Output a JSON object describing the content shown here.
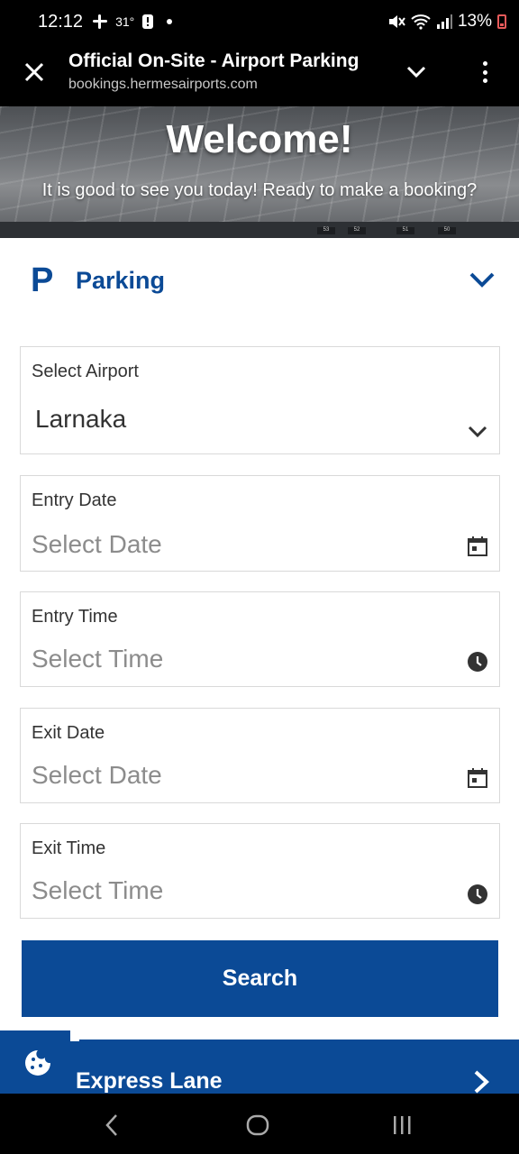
{
  "status_bar": {
    "time": "12:12",
    "temp": "31°",
    "battery": "13%"
  },
  "browser": {
    "title": "Official On-Site - Airport Parking",
    "url": "bookings.hermesairports.com"
  },
  "hero": {
    "heading": "Welcome!",
    "subheading": "It is good to see you today! Ready to make a booking?",
    "signs": [
      "53",
      "52",
      "51",
      "50"
    ]
  },
  "section": {
    "icon_letter": "P",
    "label": "Parking"
  },
  "form": {
    "airport": {
      "label": "Select Airport",
      "value": "Larnaka"
    },
    "entry_date": {
      "label": "Entry Date",
      "placeholder": "Select Date"
    },
    "entry_time": {
      "label": "Entry Time",
      "placeholder": "Select Time"
    },
    "exit_date": {
      "label": "Exit Date",
      "placeholder": "Select Date"
    },
    "exit_time": {
      "label": "Exit Time",
      "placeholder": "Select Time"
    },
    "search_label": "Search"
  },
  "express_lane": {
    "label": "Express Lane"
  },
  "colors": {
    "brand": "#0b4a96"
  },
  "icons": {
    "status_left": [
      "slack-icon",
      "notification-icon",
      "dot-icon"
    ],
    "status_right": [
      "mute-icon",
      "wifi-icon",
      "signal-icon",
      "battery-icon"
    ]
  }
}
